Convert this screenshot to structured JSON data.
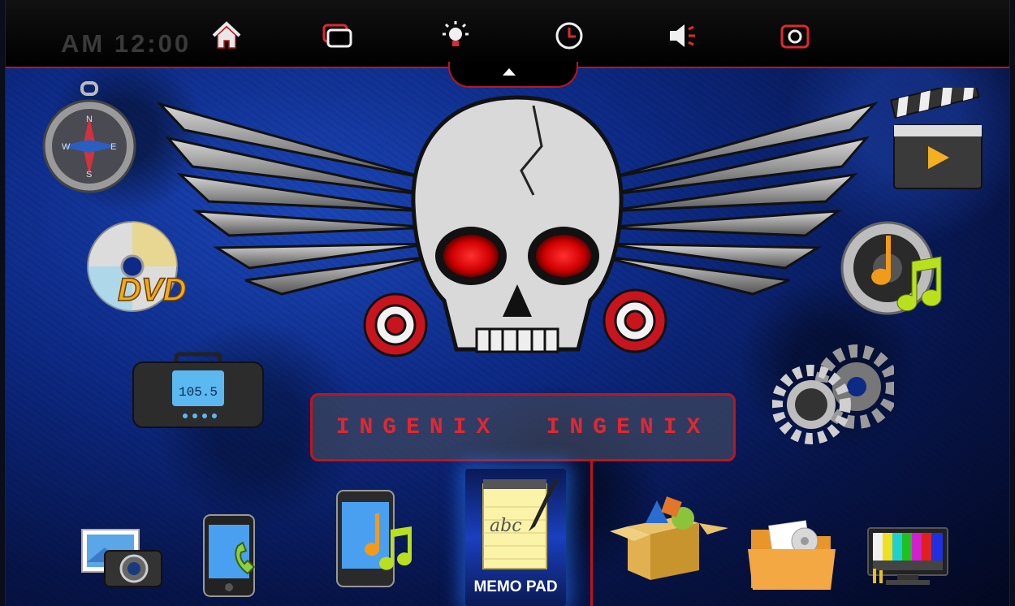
{
  "status_bar": {
    "clock_text": "AM 12:00",
    "icons": [
      {
        "name": "home-icon"
      },
      {
        "name": "windows-icon"
      },
      {
        "name": "brightness-icon"
      },
      {
        "name": "clock-icon"
      },
      {
        "name": "volume-icon"
      },
      {
        "name": "camera-icon"
      }
    ]
  },
  "banner": {
    "left_text": "INGENIX",
    "right_text": "INGENIX"
  },
  "apps": {
    "left_column": [
      {
        "name": "compass-app"
      },
      {
        "name": "dvd-app",
        "label": "DVD"
      },
      {
        "name": "radio-app",
        "display": "105.5"
      }
    ],
    "right_column": [
      {
        "name": "video-app"
      },
      {
        "name": "music-app"
      },
      {
        "name": "settings-app"
      }
    ],
    "dock": [
      {
        "name": "gallery-app"
      },
      {
        "name": "phone-app"
      },
      {
        "name": "phone-music-app"
      },
      {
        "name": "memo-pad-app",
        "label": "MEMO PAD",
        "selected": true
      },
      {
        "name": "app-store-app"
      },
      {
        "name": "file-manager-app"
      },
      {
        "name": "tv-app"
      }
    ]
  },
  "colors": {
    "accent_red": "#c0141c",
    "background_blue": "#0d2a86",
    "selection_glow": "#2878ff"
  }
}
